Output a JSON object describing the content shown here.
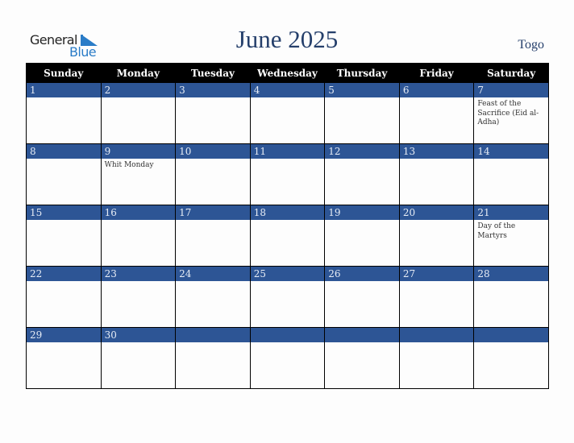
{
  "logo": {
    "line1": "General",
    "line2": "Blue"
  },
  "header": {
    "title": "June 2025",
    "country": "Togo"
  },
  "colors": {
    "header_bg": "#000000",
    "day_band": "#2d5595",
    "title": "#253f6b",
    "logo_blue": "#2a7cc7"
  },
  "weekdays": [
    "Sunday",
    "Monday",
    "Tuesday",
    "Wednesday",
    "Thursday",
    "Friday",
    "Saturday"
  ],
  "weeks": [
    [
      {
        "day": "1",
        "event": ""
      },
      {
        "day": "2",
        "event": ""
      },
      {
        "day": "3",
        "event": ""
      },
      {
        "day": "4",
        "event": ""
      },
      {
        "day": "5",
        "event": ""
      },
      {
        "day": "6",
        "event": ""
      },
      {
        "day": "7",
        "event": "Feast of the Sacrifice (Eid al-Adha)"
      }
    ],
    [
      {
        "day": "8",
        "event": ""
      },
      {
        "day": "9",
        "event": "Whit Monday"
      },
      {
        "day": "10",
        "event": ""
      },
      {
        "day": "11",
        "event": ""
      },
      {
        "day": "12",
        "event": ""
      },
      {
        "day": "13",
        "event": ""
      },
      {
        "day": "14",
        "event": ""
      }
    ],
    [
      {
        "day": "15",
        "event": ""
      },
      {
        "day": "16",
        "event": ""
      },
      {
        "day": "17",
        "event": ""
      },
      {
        "day": "18",
        "event": ""
      },
      {
        "day": "19",
        "event": ""
      },
      {
        "day": "20",
        "event": ""
      },
      {
        "day": "21",
        "event": "Day of the Martyrs"
      }
    ],
    [
      {
        "day": "22",
        "event": ""
      },
      {
        "day": "23",
        "event": ""
      },
      {
        "day": "24",
        "event": ""
      },
      {
        "day": "25",
        "event": ""
      },
      {
        "day": "26",
        "event": ""
      },
      {
        "day": "27",
        "event": ""
      },
      {
        "day": "28",
        "event": ""
      }
    ],
    [
      {
        "day": "29",
        "event": ""
      },
      {
        "day": "30",
        "event": ""
      },
      {
        "day": "",
        "event": ""
      },
      {
        "day": "",
        "event": ""
      },
      {
        "day": "",
        "event": ""
      },
      {
        "day": "",
        "event": ""
      },
      {
        "day": "",
        "event": ""
      }
    ]
  ]
}
